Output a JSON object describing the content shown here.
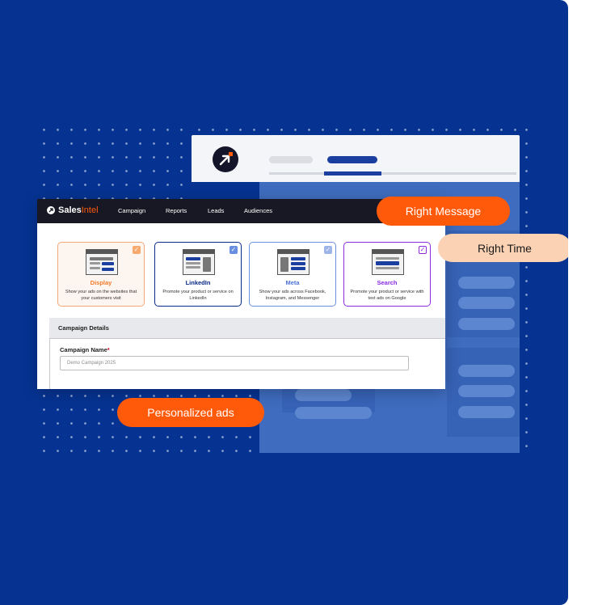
{
  "navbar": {
    "brand_prefix": "Sales",
    "brand_suffix": "Intel",
    "items": [
      "Campaign",
      "Reports",
      "Leads",
      "Audiences"
    ]
  },
  "channels": [
    {
      "title": "Display",
      "desc": "Show your ads on the websites that your customers visit",
      "color": "#f07a2a",
      "border": "#f4a777",
      "bg": "#fdf6f0",
      "checked": true
    },
    {
      "title": "LinkedIn",
      "desc": "Promote your product or service on LinkedIn",
      "color": "#0a2a8a",
      "border": "#0a2a8a",
      "bg": "#ffffff",
      "checked": true
    },
    {
      "title": "Meta",
      "desc": "Show your ads across Facebook, Instagram, and Messenger",
      "color": "#4d73d6",
      "border": "#6b8fe0",
      "bg": "#ffffff",
      "checked": true
    },
    {
      "title": "Search",
      "desc": "Promote your product or service with text ads on Google",
      "color": "#8a2be2",
      "border": "#8a2be2",
      "bg": "#ffffff",
      "checked": true
    }
  ],
  "campaign_details": {
    "section_title": "Campaign Details",
    "name_label": "Campaign Name",
    "required_mark": "*",
    "name_value": "Demo Campaign 2025"
  },
  "tags": {
    "right_message": "Right Message",
    "right_time": "Right Time",
    "personalized_ads": "Personalized ads"
  },
  "colors": {
    "background": "#063392",
    "accent_orange": "#ff5a0a",
    "peach": "#fcd2b4"
  }
}
